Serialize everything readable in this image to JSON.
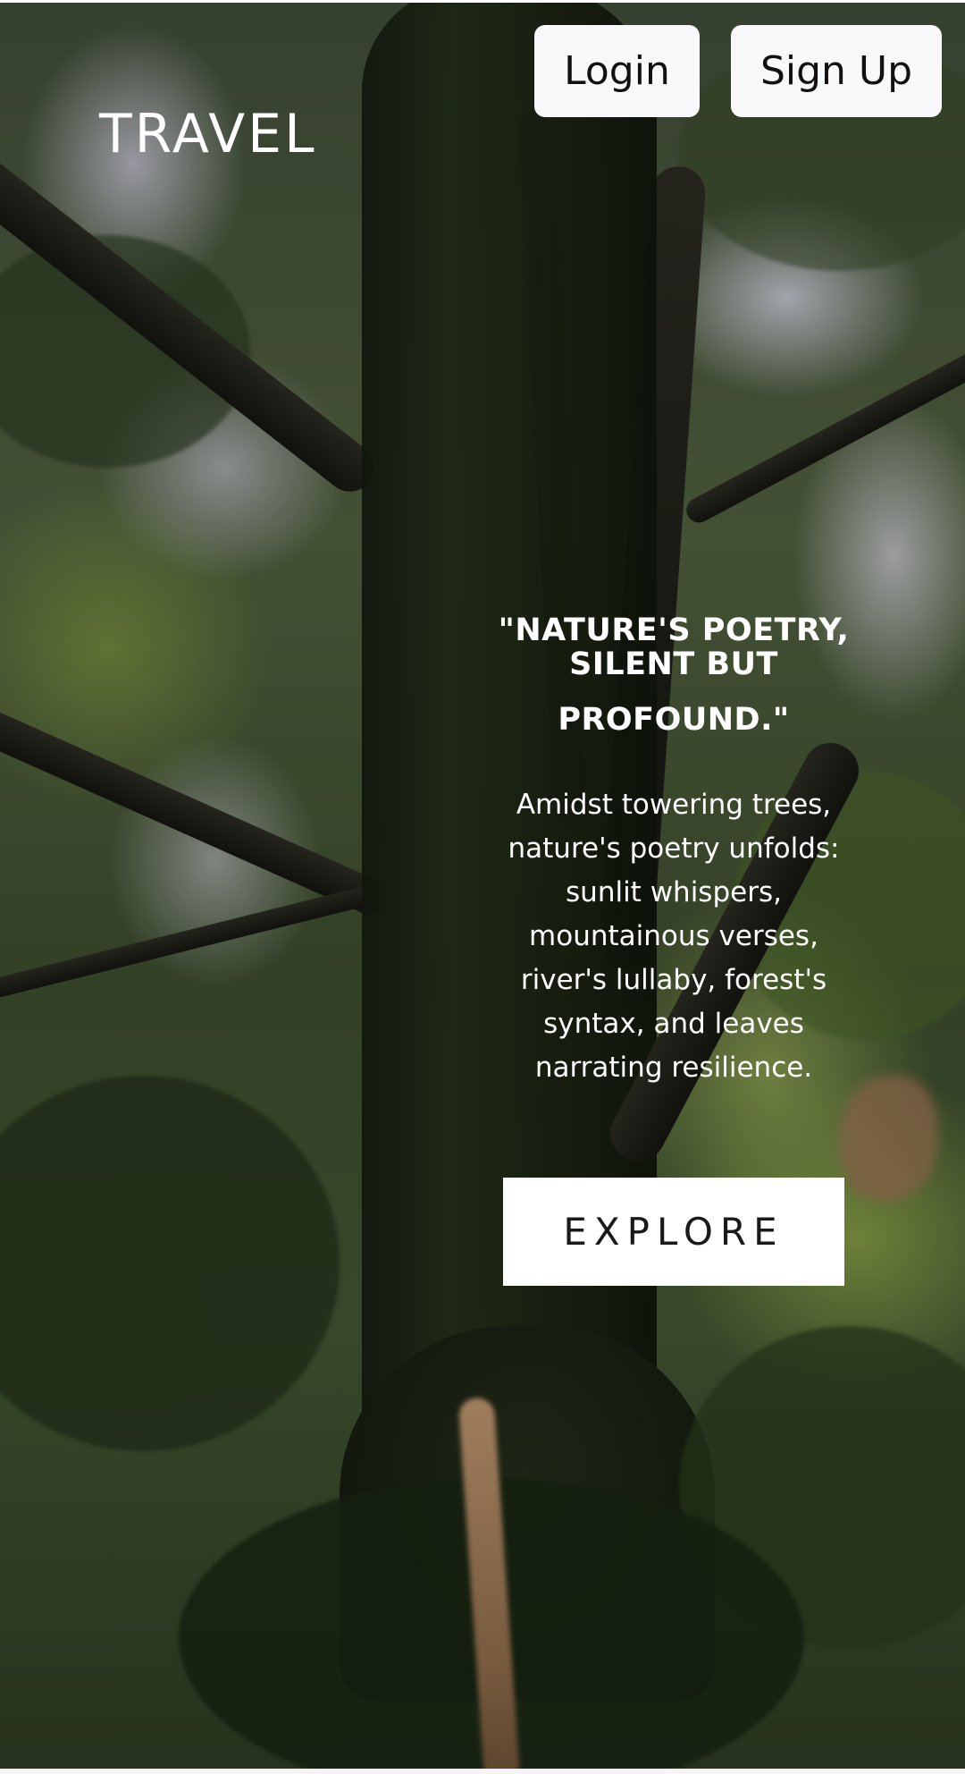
{
  "header": {
    "brand": "TRAVEL",
    "login_label": "Login",
    "signup_label": "Sign Up"
  },
  "hero": {
    "title_line1": "\"NATURE'S POETRY, SILENT BUT",
    "title_line2": "PROFOUND.\"",
    "text": "Amidst towering trees, nature's poetry unfolds: sunlit whispers, mountainous verses, river's lullaby, forest's syntax, and leaves narrating resilience.",
    "cta_label": "EXPLORE"
  }
}
